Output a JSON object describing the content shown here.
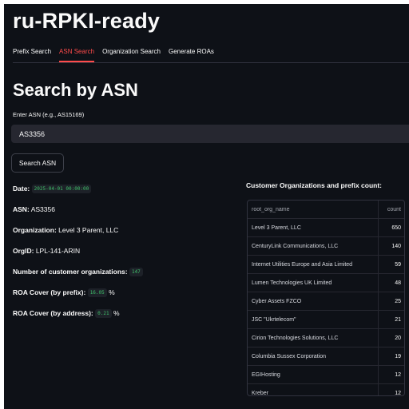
{
  "app": {
    "title": "ru-RPKI-ready"
  },
  "tabs": [
    {
      "label": "Prefix Search"
    },
    {
      "label": "ASN Search"
    },
    {
      "label": "Organization Search"
    },
    {
      "label": "Generate ROAs"
    }
  ],
  "active_tab": "ASN Search",
  "page": {
    "title": "Search by ASN",
    "input_label": "Enter ASN (e.g., AS15169)",
    "input_value": "AS3356",
    "button_label": "Search ASN"
  },
  "results": {
    "date_label": "Date:",
    "date_value": "2025-04-01 00:00:00",
    "asn_label": "ASN:",
    "asn_value": "AS3356",
    "org_label": "Organization:",
    "org_value": "Level 3 Parent, LLC",
    "orgid_label": "OrgID:",
    "orgid_value": "LPL-141-ARIN",
    "customers_label": "Number of customer organizations:",
    "customers_value": "147",
    "roa_prefix_label": "ROA Cover (by prefix):",
    "roa_prefix_value": "16.05",
    "roa_address_label": "ROA Cover (by address):",
    "roa_address_value": "0.21",
    "percent": "%"
  },
  "table": {
    "title": "Customer Organizations and prefix count:",
    "columns": [
      "root_org_name",
      "count"
    ],
    "rows": [
      {
        "name": "Level 3 Parent, LLC",
        "count": "650"
      },
      {
        "name": "CenturyLink Communications, LLC",
        "count": "140"
      },
      {
        "name": "Internet Utilities Europe and Asia Limited",
        "count": "59"
      },
      {
        "name": "Lumen Technologies UK Limited",
        "count": "48"
      },
      {
        "name": "Cyber Assets FZCO",
        "count": "25"
      },
      {
        "name": "JSC \"Ukrtelecom\"",
        "count": "21"
      },
      {
        "name": "Cirion Technologies Solutions, LLC",
        "count": "20"
      },
      {
        "name": "Columbia Sussex Corporation",
        "count": "19"
      },
      {
        "name": "EGIHosting",
        "count": "12"
      },
      {
        "name": "Kreber",
        "count": "12"
      }
    ]
  },
  "colors": {
    "background": "#0e1117",
    "accent": "#ff4b4b",
    "code_text": "#3fbf6a",
    "input_bg": "#262730"
  }
}
